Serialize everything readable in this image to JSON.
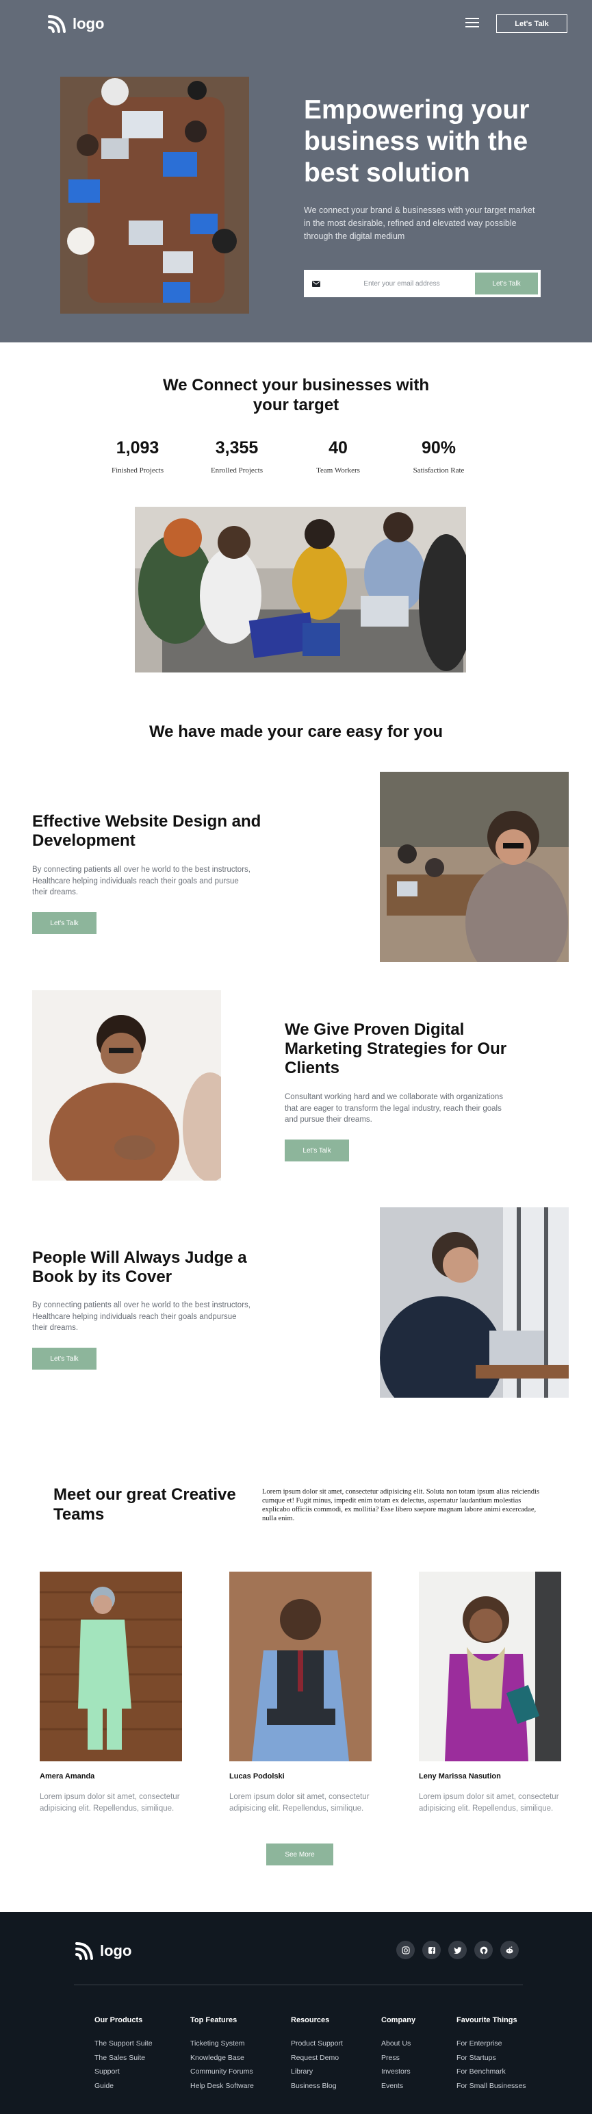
{
  "brand": {
    "logo_text": "logo",
    "accent": "#8db59b",
    "hero_bg": "#636b78",
    "footer_bg": "#111820"
  },
  "nav": {
    "menu_icon": "hamburger-icon",
    "cta_label": "Let's Talk"
  },
  "hero": {
    "title": "Empowering your business with the best solution",
    "subtitle": "We connect your brand & businesses with your target market in the most desirable, refined and elevated way possible through the digital medium",
    "email_placeholder": "Enter your email address",
    "email_icon": "mail-icon",
    "cta_label": "Let's Talk"
  },
  "connect": {
    "title": "We Connect your businesses with your target",
    "stats": [
      {
        "value": "1,093",
        "label": "Finished Projects"
      },
      {
        "value": "3,355",
        "label": "Enrolled Projects"
      },
      {
        "value": "40",
        "label": "Team Workers"
      },
      {
        "value": "90%",
        "label": "Satisfaction Rate"
      }
    ]
  },
  "care": {
    "title": "We have made your care easy for you",
    "features": [
      {
        "title": "Effective Website Design and Development",
        "desc": "By connecting patients all over he world to the best instructors, Healthcare helping individuals reach their goals and pursue their dreams.",
        "cta": "Let's Talk"
      },
      {
        "title": "We Give Proven Digital Marketing Strategies for Our Clients",
        "desc": "Consultant working hard and we collaborate with organizations that are eager to transform the legal industry, reach their goals and pursue their dreams.",
        "cta": "Let's Talk"
      },
      {
        "title": "People Will Always Judge a Book by its Cover",
        "desc": "By connecting patients all over he world to the best instructors, Healthcare helping individuals reach their goals andpursue their dreams.",
        "cta": "Let's Talk"
      }
    ]
  },
  "team": {
    "title": "Meet our great Creative Teams",
    "intro": "Lorem ipsum dolor sit amet, consectetur adipisicing elit. Soluta non totam ipsum alias reiciendis cumque et! Fugit minus, impedit enim totam ex delectus, aspernatur laudantium molestias explicabo officiis commodi, ex mollitia? Esse libero saepore magnam labore animi excercadae, nulla enim.",
    "members": [
      {
        "name": "Amera Amanda",
        "desc": "Lorem ipsum dolor sit amet, consectetur adipisicing elit. Repellendus, similique."
      },
      {
        "name": "Lucas Podolski",
        "desc": "Lorem ipsum dolor sit amet, consectetur adipisicing elit. Repellendus, similique."
      },
      {
        "name": "Leny Marissa Nasution",
        "desc": "Lorem ipsum dolor sit amet, consectetur adipisicing elit. Repellendus, similique."
      }
    ],
    "see_more": "See More"
  },
  "footer": {
    "logo_text": "logo",
    "socials": [
      "instagram-icon",
      "facebook-icon",
      "twitter-icon",
      "github-icon",
      "reddit-icon"
    ],
    "columns": [
      {
        "title": "Our Products",
        "links": [
          "The Support Suite",
          "The Sales Suite",
          "Support",
          "Guide"
        ]
      },
      {
        "title": "Top Features",
        "links": [
          "Ticketing System",
          "Knowledge Base",
          "Community Forums",
          "Help Desk Software"
        ]
      },
      {
        "title": "Resources",
        "links": [
          "Product Support",
          "Request Demo",
          "Library",
          "Business Blog"
        ]
      },
      {
        "title": "Company",
        "links": [
          "About Us",
          "Press",
          "Investors",
          "Events"
        ]
      },
      {
        "title": "Favourite Things",
        "links": [
          "For Enterprise",
          "For Startups",
          "For Benchmark",
          "For Small Businesses"
        ]
      }
    ]
  }
}
